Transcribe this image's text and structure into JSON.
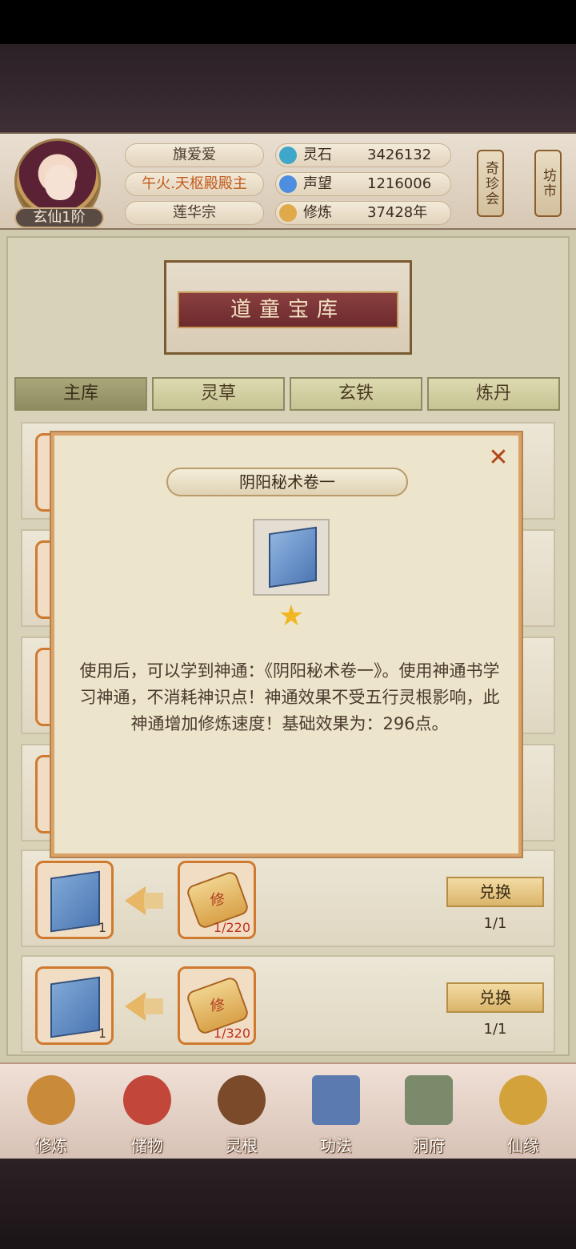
{
  "player": {
    "rank": "玄仙1阶",
    "name": "旗爱爱",
    "title": "午火.天枢殿殿主",
    "sect": "莲华宗"
  },
  "stats": [
    {
      "icon": "spirit-stone-icon",
      "label": "灵石",
      "value": "3426132"
    },
    {
      "icon": "prestige-icon",
      "label": "声望",
      "value": "1216006"
    },
    {
      "icon": "cultivation-icon",
      "label": "修炼",
      "value": "37428年"
    }
  ],
  "side_buttons": {
    "treasure_fair": "奇珍会",
    "market": "坊市"
  },
  "banner": {
    "title": "道童宝库"
  },
  "tabs": [
    {
      "label": "主库",
      "active": true
    },
    {
      "label": "灵草",
      "active": false
    },
    {
      "label": "玄铁",
      "active": false
    },
    {
      "label": "炼丹",
      "active": false
    }
  ],
  "rows": [
    {
      "item_count": "1",
      "cost": "1/220",
      "button": "兑换",
      "limit": "1/1"
    },
    {
      "item_count": "1",
      "cost": "1/320",
      "button": "兑换",
      "limit": "1/1"
    }
  ],
  "scroll_char": "修",
  "modal": {
    "title": "阴阳秘术卷一",
    "close": "✕",
    "star": "★",
    "description": "使用后，可以学到神通：《阴阳秘术卷一》。使用神通书学习神通，不消耗神识点！神通效果不受五行灵根影响，此神通增加修炼速度！基础效果为：296点。"
  },
  "nav": [
    {
      "label": "修炼",
      "icon": "meditation-icon",
      "color": "#c98a3a"
    },
    {
      "label": "储物",
      "icon": "bag-icon",
      "color": "#c2463a"
    },
    {
      "label": "灵根",
      "icon": "root-icon",
      "color": "#7a4a2a"
    },
    {
      "label": "功法",
      "icon": "book-icon",
      "color": "#5a7ab0"
    },
    {
      "label": "洞府",
      "icon": "cave-palace-icon",
      "color": "#7a8a6a"
    },
    {
      "label": "仙缘",
      "icon": "gourd-icon",
      "color": "#d4a23a"
    }
  ],
  "colors": {
    "accent": "#d07a2f",
    "title_red": "#c25a1c",
    "cost_red": "#c0301e"
  }
}
